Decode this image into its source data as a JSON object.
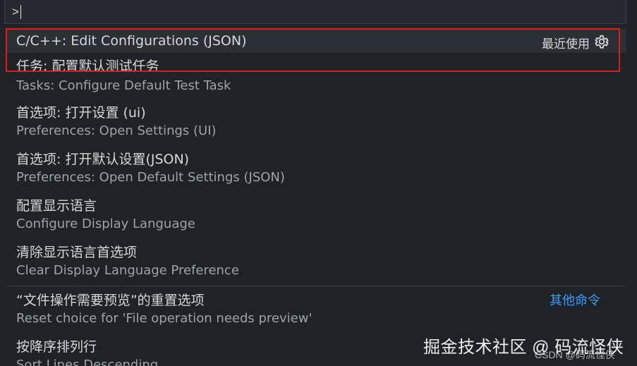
{
  "command_palette": {
    "input_value": ">"
  },
  "items": [
    {
      "label": "C/C++: Edit Configurations (JSON)",
      "right_tag": "最近使用"
    },
    {
      "label": "任务: 配置默认测试任务",
      "detail": "Tasks: Configure Default Test Task"
    },
    {
      "label": "首选项: 打开设置 (ui)",
      "detail": "Preferences: Open Settings (UI)"
    },
    {
      "label": "首选项: 打开默认设置(JSON)",
      "detail": "Preferences: Open Default Settings (JSON)"
    },
    {
      "label": "配置显示语言",
      "detail": "Configure Display Language"
    },
    {
      "label": "清除显示语言首选项",
      "detail": "Clear Display Language Preference"
    },
    {
      "label": "“文件操作需要预览”的重置选项",
      "detail": "Reset choice for 'File operation needs preview'",
      "right_link": "其他命令"
    },
    {
      "label": "按降序排列行",
      "detail": "Sort Lines Descending"
    }
  ],
  "watermark": {
    "main": "掘金技术社区 @ 码流怪侠",
    "sub": "CSDN @码流怪侠"
  },
  "colors": {
    "background": "#1f2328",
    "selected_row": "#2b3037",
    "annotation_red": "#e11b1b",
    "link_blue": "#3b9cff"
  },
  "icons": {
    "settings": "gear-icon"
  }
}
